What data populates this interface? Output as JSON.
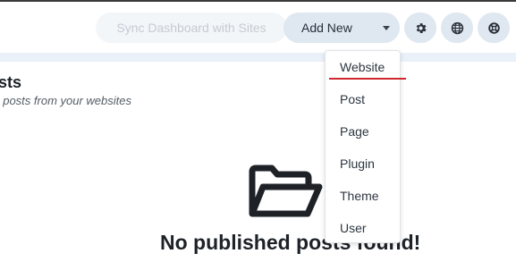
{
  "header": {
    "sync_label": "Sync Dashboard with Sites",
    "add_new_label": "Add New",
    "icons": [
      "gear-icon",
      "globe-icon",
      "lifebuoy-icon"
    ]
  },
  "page": {
    "title": "sts",
    "subtitle": "t posts from your websites"
  },
  "empty_state": {
    "icon": "open-folder-icon",
    "message": "No published posts found!"
  },
  "dropdown": {
    "items": [
      {
        "label": "Website"
      },
      {
        "label": "Post"
      },
      {
        "label": "Page"
      },
      {
        "label": "Plugin"
      },
      {
        "label": "Theme"
      },
      {
        "label": "User"
      }
    ],
    "active_item": "Website",
    "active_color": "#d0262d"
  }
}
